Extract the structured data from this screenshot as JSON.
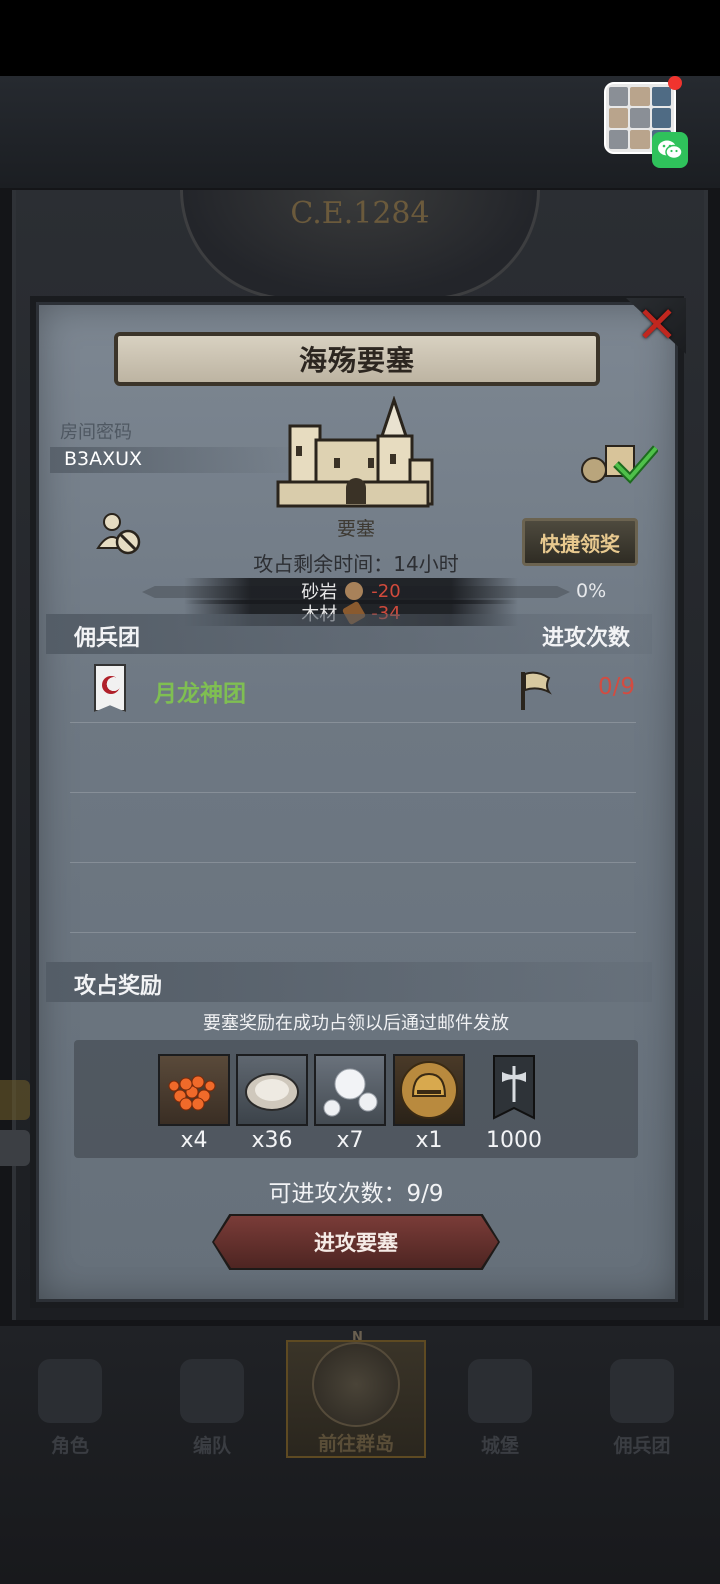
{
  "era": "C.E.1284",
  "dialog": {
    "title": "海殇要塞",
    "close_icon": "close-x-icon",
    "room": {
      "label": "房间密码",
      "code": "B3AXUX"
    },
    "fortress_label": "要塞",
    "quick_claim_label": "快捷领奖",
    "remaining_time": "攻占剩余时间：14小时",
    "resources": [
      {
        "name": "木材",
        "value": "-34",
        "icon": "wood-icon",
        "color": "#8a5a2e"
      },
      {
        "name": "砂岩",
        "value": "-20",
        "icon": "sandstone-icon",
        "color": "#a8825a"
      }
    ],
    "progress": {
      "value": 0,
      "label": "0%"
    },
    "mercenary_section": {
      "title": "佣兵团",
      "attacks_header": "进攻次数"
    },
    "guilds": [
      {
        "name": "月龙神团",
        "attacks": "0/9",
        "flag_icon": "flag-icon",
        "banner_icon": "guild-banner-icon"
      }
    ],
    "rewards": {
      "title": "攻占奖励",
      "note": "要塞奖励在成功占领以后通过邮件发放",
      "items": [
        {
          "icon": "fish-roe-icon",
          "qty": "x4"
        },
        {
          "icon": "oyster-icon",
          "qty": "x36"
        },
        {
          "icon": "pearl-icon",
          "qty": "x7"
        },
        {
          "icon": "knight-helmet-icon",
          "qty": "x1"
        },
        {
          "icon": "guild-banner-axe-icon",
          "qty": "1000"
        }
      ]
    },
    "attacks_available": "可进攻次数：9/9",
    "attack_button_label": "进攻要塞"
  },
  "bottom_nav": {
    "items": [
      {
        "label": "角色",
        "icon": "knight-icon",
        "active": false
      },
      {
        "label": "编队",
        "icon": "helmet-icon",
        "active": false
      },
      {
        "label": "前往群岛",
        "icon": "compass-icon",
        "active": true
      },
      {
        "label": "城堡",
        "icon": "castle-icon",
        "active": false
      },
      {
        "label": "佣兵团",
        "icon": "ship-icon",
        "active": false
      }
    ],
    "compass_n": "N"
  },
  "colors": {
    "panel": "#6e7883",
    "guild_name": "#7fbf52",
    "negative": "#d04a3c",
    "close": "#c0271f",
    "quick_claim_text": "#e8c98f"
  }
}
